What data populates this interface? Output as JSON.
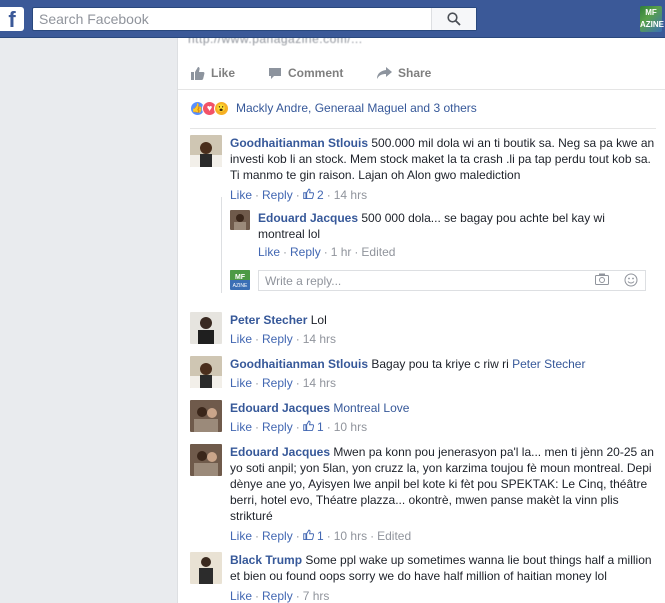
{
  "search": {
    "placeholder": "Search Facebook"
  },
  "app_icon_text": "MF\nAZINE",
  "post": {
    "link_text": "http://www.panagazine.com/...",
    "actions": {
      "like": "Like",
      "comment": "Comment",
      "share": "Share"
    },
    "reactions": {
      "names": "Mackly Andre, Generaal Maguel and 3 others",
      "types": [
        "like",
        "love",
        "wow"
      ]
    }
  },
  "comments": [
    {
      "name": "Goodhaitianman Stlouis",
      "text": "500.000 mil dola wi an ti boutik sa. Neg sa pa kwe an investi kob li an stock. Mem stock maket la ta crash .li pa tap perdu tout kob sa. Ti manmo te gin raison. Lajan oh Alon gwo malediction",
      "like": "Like",
      "reply": "Reply",
      "likes": "2",
      "time": "14 hrs"
    },
    {
      "name": "Edouard Jacques",
      "text": "500 000 dola... se bagay pou achte bel kay wi montreal lol",
      "like": "Like",
      "reply": "Reply",
      "time": "1 hr",
      "edited": "Edited"
    },
    {
      "name": "Peter Stecher",
      "text": "Lol",
      "like": "Like",
      "reply": "Reply",
      "time": "14 hrs"
    },
    {
      "name": "Goodhaitianman Stlouis",
      "text": "Bagay pou ta kriye c riw ri",
      "mention": "Peter Stecher",
      "like": "Like",
      "reply": "Reply",
      "time": "14 hrs"
    },
    {
      "name": "Edouard Jacques",
      "link_text": "Montreal Love",
      "like": "Like",
      "reply": "Reply",
      "likes": "1",
      "time": "10 hrs"
    },
    {
      "name": "Edouard Jacques",
      "text": "Mwen pa konn pou jenerasyon pa'l la... men ti jènn 20-25 an yo soti anpil; yon 5lan, yon cruzz la, yon karzima toujou fè moun montreal. Depi dènye ane yo, Ayisyen lwe anpil bel kote ki fèt pou SPEKTAK: Le Cinq, théâtre berri, hotel evo, Théatre plazza... okontrè, mwen panse makèt la vinn plis strikturé",
      "like": "Like",
      "reply": "Reply",
      "likes": "1",
      "time": "10 hrs",
      "edited": "Edited"
    },
    {
      "name": "Black Trump",
      "text": "Some ppl wake up sometimes wanna lie bout things half a million et bien ou found oops sorry we do have half million of haitian money lol",
      "like": "Like",
      "reply": "Reply",
      "time": "7 hrs"
    }
  ],
  "write_reply": {
    "placeholder": "Write a reply..."
  },
  "colors": {
    "brand": "#3b5998",
    "link": "#365899",
    "meta": "#90949c"
  }
}
